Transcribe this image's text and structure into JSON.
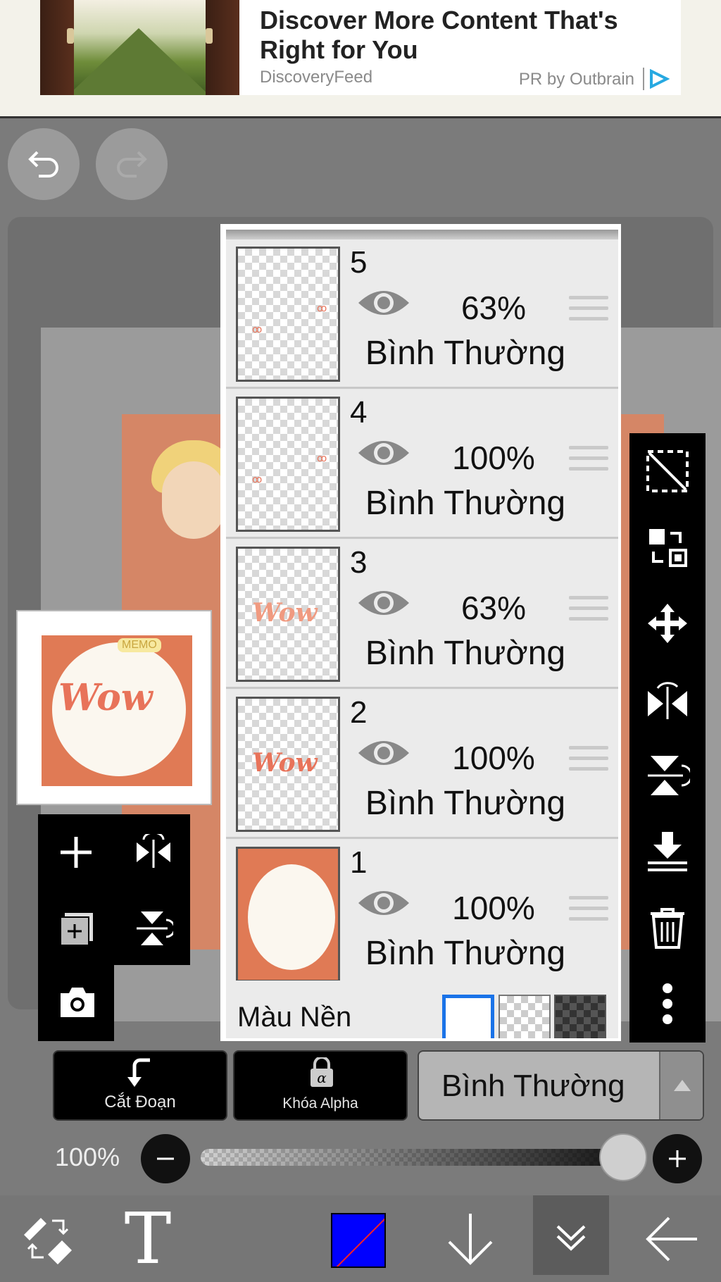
{
  "ad": {
    "title": "Discover More Content That's Right for You",
    "source": "DiscoveryFeed",
    "pr_label": "PR by Outbrain"
  },
  "toolbar": {
    "undo_icon": "undo-icon",
    "redo_icon": "redo-icon"
  },
  "layers": [
    {
      "number": "5",
      "opacity": "63%",
      "mode": "Bình Thường",
      "thumb": "hearts"
    },
    {
      "number": "4",
      "opacity": "100%",
      "mode": "Bình Thường",
      "thumb": "hearts"
    },
    {
      "number": "3",
      "opacity": "63%",
      "mode": "Bình Thường",
      "thumb": "wow-light"
    },
    {
      "number": "2",
      "opacity": "100%",
      "mode": "Bình Thường",
      "thumb": "wow-dark"
    },
    {
      "number": "1",
      "opacity": "100%",
      "mode": "Bình Thường",
      "thumb": "frame"
    }
  ],
  "background": {
    "label": "Màu Nền",
    "options": [
      "white",
      "transparent",
      "dark"
    ],
    "selected": "white"
  },
  "buttons": {
    "clipping": "Cắt Đoạn",
    "alpha_lock": "Khóa Alpha"
  },
  "blend_mode": {
    "value": "Bình Thường"
  },
  "opacity_slider": {
    "label": "100%",
    "value": 1.0
  },
  "thumbnail": {
    "wow": "Wow",
    "memo": "MEMO"
  },
  "bottom_nav": {
    "text_tool": "T",
    "primary_color": "#0000ff"
  },
  "colors": {
    "accent_selected": "#1a73e8",
    "art_main": "#e07a55"
  }
}
